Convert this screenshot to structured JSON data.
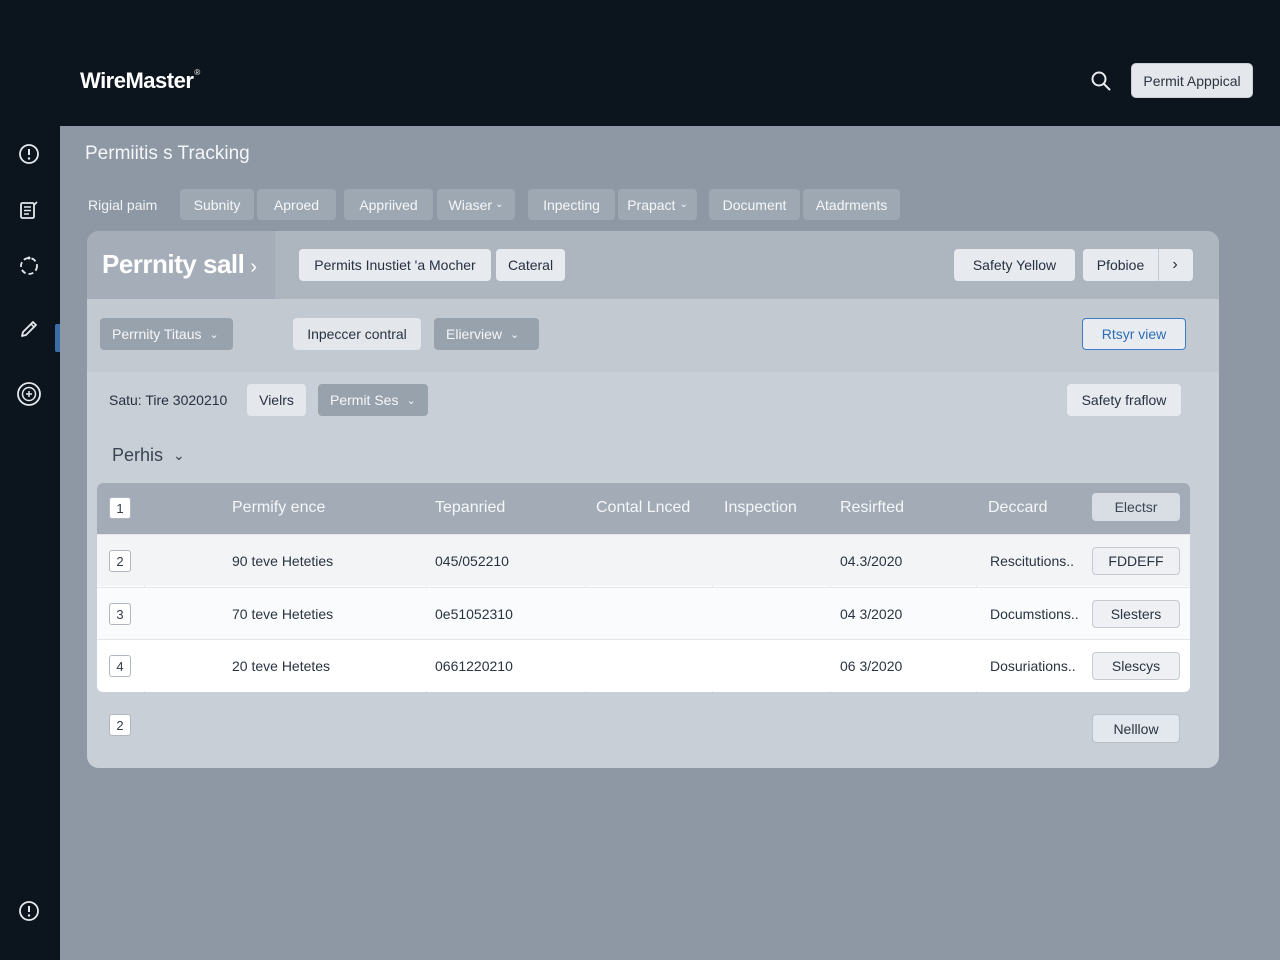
{
  "app": {
    "logo": "WireMaster",
    "logo_mark": "®",
    "header_button": "Permit Apppical"
  },
  "page": {
    "title": "Permiitis s Tracking"
  },
  "tabs": {
    "label": "Rigial paim",
    "items": [
      "Subnity",
      "Aproed",
      "Appriived",
      "Wiaser",
      "Inpecting",
      "Prapact",
      "Document",
      "Atadrments"
    ]
  },
  "panel": {
    "title": "Perrnity sall",
    "chip_primary": "Permits Inustiet 'a Mocher",
    "chip_secondary": "Cateral",
    "right_chip": "Safety Yellow",
    "profile_chip": "Pfobioe"
  },
  "filters": {
    "status_dropdown": "Perrnity Titaus",
    "inspector": "Inpeccer contral",
    "overview_dropdown": "Elierview",
    "view_button": "Rtsyr view"
  },
  "substatus": {
    "text": "Satu: Tire 3020210",
    "views": "Vielrs",
    "permit_dropdown": "Permit Ses",
    "safety": "Safety fraflow"
  },
  "section": {
    "title": "Perhis"
  },
  "table": {
    "header_badge": "1",
    "columns": [
      "Permify ence",
      "Tepanried",
      "Contal Lnced",
      "Inspection",
      "Resirfted",
      "Deccard"
    ],
    "header_button": "Electsr",
    "rows": [
      {
        "num": "2",
        "name": "90 teve Heteties",
        "code": "045/052210",
        "date": "04.3/2020",
        "doc": "Rescitutions..",
        "action": "FDDEFF"
      },
      {
        "num": "3",
        "name": "70 teve Heteties",
        "code": "0e51052310",
        "date": "04 3/2020",
        "doc": "Documstions..",
        "action": "Slesters"
      },
      {
        "num": "4",
        "name": "20 teve Hetetes",
        "code": "0661220210",
        "date": "06 3/2020",
        "doc": "Dosuriations..",
        "action": "Slescys"
      }
    ]
  },
  "footer": {
    "page_badge": "2",
    "button": "Nelllow"
  },
  "icons": {
    "search": "search-icon",
    "sidebar": [
      "alert-circle-icon",
      "document-list-icon",
      "sync-icon",
      "pencil-icon",
      "badge-icon",
      "info-circle-icon"
    ]
  },
  "colors": {
    "header_bg": "#0c141d",
    "main_bg": "#8d98a4",
    "accent": "#3d7cc9"
  }
}
